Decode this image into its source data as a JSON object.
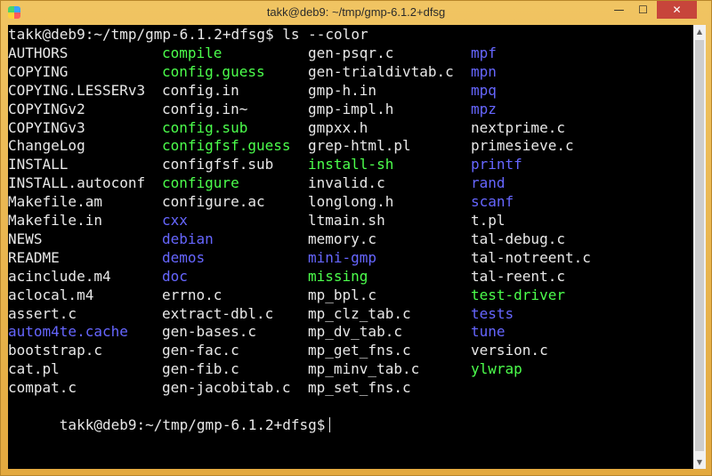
{
  "window": {
    "title": "takk@deb9: ~/tmp/gmp-6.1.2+dfsg",
    "min_glyph": "—",
    "max_glyph": "☐",
    "close_glyph": "✕",
    "app_icon": "terminal-app-icon"
  },
  "colors": {
    "plain": "#e8e8e8",
    "exec": "#4cff4c",
    "dir": "#6666ff"
  },
  "terminal": {
    "command_line": "takk@deb9:~/tmp/gmp-6.1.2+dfsg$ ls --color",
    "final_prompt": "takk@deb9:~/tmp/gmp-6.1.2+dfsg$",
    "rows": [
      [
        {
          "t": "AUTHORS",
          "k": "plain"
        },
        {
          "t": "compile",
          "k": "exec"
        },
        {
          "t": "gen-psqr.c",
          "k": "plain"
        },
        {
          "t": "mpf",
          "k": "dir"
        }
      ],
      [
        {
          "t": "COPYING",
          "k": "plain"
        },
        {
          "t": "config.guess",
          "k": "exec"
        },
        {
          "t": "gen-trialdivtab.c",
          "k": "plain"
        },
        {
          "t": "mpn",
          "k": "dir"
        }
      ],
      [
        {
          "t": "COPYING.LESSERv3",
          "k": "plain"
        },
        {
          "t": "config.in",
          "k": "plain"
        },
        {
          "t": "gmp-h.in",
          "k": "plain"
        },
        {
          "t": "mpq",
          "k": "dir"
        }
      ],
      [
        {
          "t": "COPYINGv2",
          "k": "plain"
        },
        {
          "t": "config.in~",
          "k": "plain"
        },
        {
          "t": "gmp-impl.h",
          "k": "plain"
        },
        {
          "t": "mpz",
          "k": "dir"
        }
      ],
      [
        {
          "t": "COPYINGv3",
          "k": "plain"
        },
        {
          "t": "config.sub",
          "k": "exec"
        },
        {
          "t": "gmpxx.h",
          "k": "plain"
        },
        {
          "t": "nextprime.c",
          "k": "plain"
        }
      ],
      [
        {
          "t": "ChangeLog",
          "k": "plain"
        },
        {
          "t": "configfsf.guess",
          "k": "exec"
        },
        {
          "t": "grep-html.pl",
          "k": "plain"
        },
        {
          "t": "primesieve.c",
          "k": "plain"
        }
      ],
      [
        {
          "t": "INSTALL",
          "k": "plain"
        },
        {
          "t": "configfsf.sub",
          "k": "plain"
        },
        {
          "t": "install-sh",
          "k": "exec"
        },
        {
          "t": "printf",
          "k": "dir"
        }
      ],
      [
        {
          "t": "INSTALL.autoconf",
          "k": "plain"
        },
        {
          "t": "configure",
          "k": "exec"
        },
        {
          "t": "invalid.c",
          "k": "plain"
        },
        {
          "t": "rand",
          "k": "dir"
        }
      ],
      [
        {
          "t": "Makefile.am",
          "k": "plain"
        },
        {
          "t": "configure.ac",
          "k": "plain"
        },
        {
          "t": "longlong.h",
          "k": "plain"
        },
        {
          "t": "scanf",
          "k": "dir"
        }
      ],
      [
        {
          "t": "Makefile.in",
          "k": "plain"
        },
        {
          "t": "cxx",
          "k": "dir"
        },
        {
          "t": "ltmain.sh",
          "k": "plain"
        },
        {
          "t": "t.pl",
          "k": "plain"
        }
      ],
      [
        {
          "t": "NEWS",
          "k": "plain"
        },
        {
          "t": "debian",
          "k": "dir"
        },
        {
          "t": "memory.c",
          "k": "plain"
        },
        {
          "t": "tal-debug.c",
          "k": "plain"
        }
      ],
      [
        {
          "t": "README",
          "k": "plain"
        },
        {
          "t": "demos",
          "k": "dir"
        },
        {
          "t": "mini-gmp",
          "k": "dir"
        },
        {
          "t": "tal-notreent.c",
          "k": "plain"
        }
      ],
      [
        {
          "t": "acinclude.m4",
          "k": "plain"
        },
        {
          "t": "doc",
          "k": "dir"
        },
        {
          "t": "missing",
          "k": "exec"
        },
        {
          "t": "tal-reent.c",
          "k": "plain"
        }
      ],
      [
        {
          "t": "aclocal.m4",
          "k": "plain"
        },
        {
          "t": "errno.c",
          "k": "plain"
        },
        {
          "t": "mp_bpl.c",
          "k": "plain"
        },
        {
          "t": "test-driver",
          "k": "exec"
        }
      ],
      [
        {
          "t": "assert.c",
          "k": "plain"
        },
        {
          "t": "extract-dbl.c",
          "k": "plain"
        },
        {
          "t": "mp_clz_tab.c",
          "k": "plain"
        },
        {
          "t": "tests",
          "k": "dir"
        }
      ],
      [
        {
          "t": "autom4te.cache",
          "k": "dir"
        },
        {
          "t": "gen-bases.c",
          "k": "plain"
        },
        {
          "t": "mp_dv_tab.c",
          "k": "plain"
        },
        {
          "t": "tune",
          "k": "dir"
        }
      ],
      [
        {
          "t": "bootstrap.c",
          "k": "plain"
        },
        {
          "t": "gen-fac.c",
          "k": "plain"
        },
        {
          "t": "mp_get_fns.c",
          "k": "plain"
        },
        {
          "t": "version.c",
          "k": "plain"
        }
      ],
      [
        {
          "t": "cat.pl",
          "k": "plain"
        },
        {
          "t": "gen-fib.c",
          "k": "plain"
        },
        {
          "t": "mp_minv_tab.c",
          "k": "plain"
        },
        {
          "t": "ylwrap",
          "k": "exec"
        }
      ],
      [
        {
          "t": "compat.c",
          "k": "plain"
        },
        {
          "t": "gen-jacobitab.c",
          "k": "plain"
        },
        {
          "t": "mp_set_fns.c",
          "k": "plain"
        },
        {
          "t": "",
          "k": "plain"
        }
      ]
    ]
  }
}
